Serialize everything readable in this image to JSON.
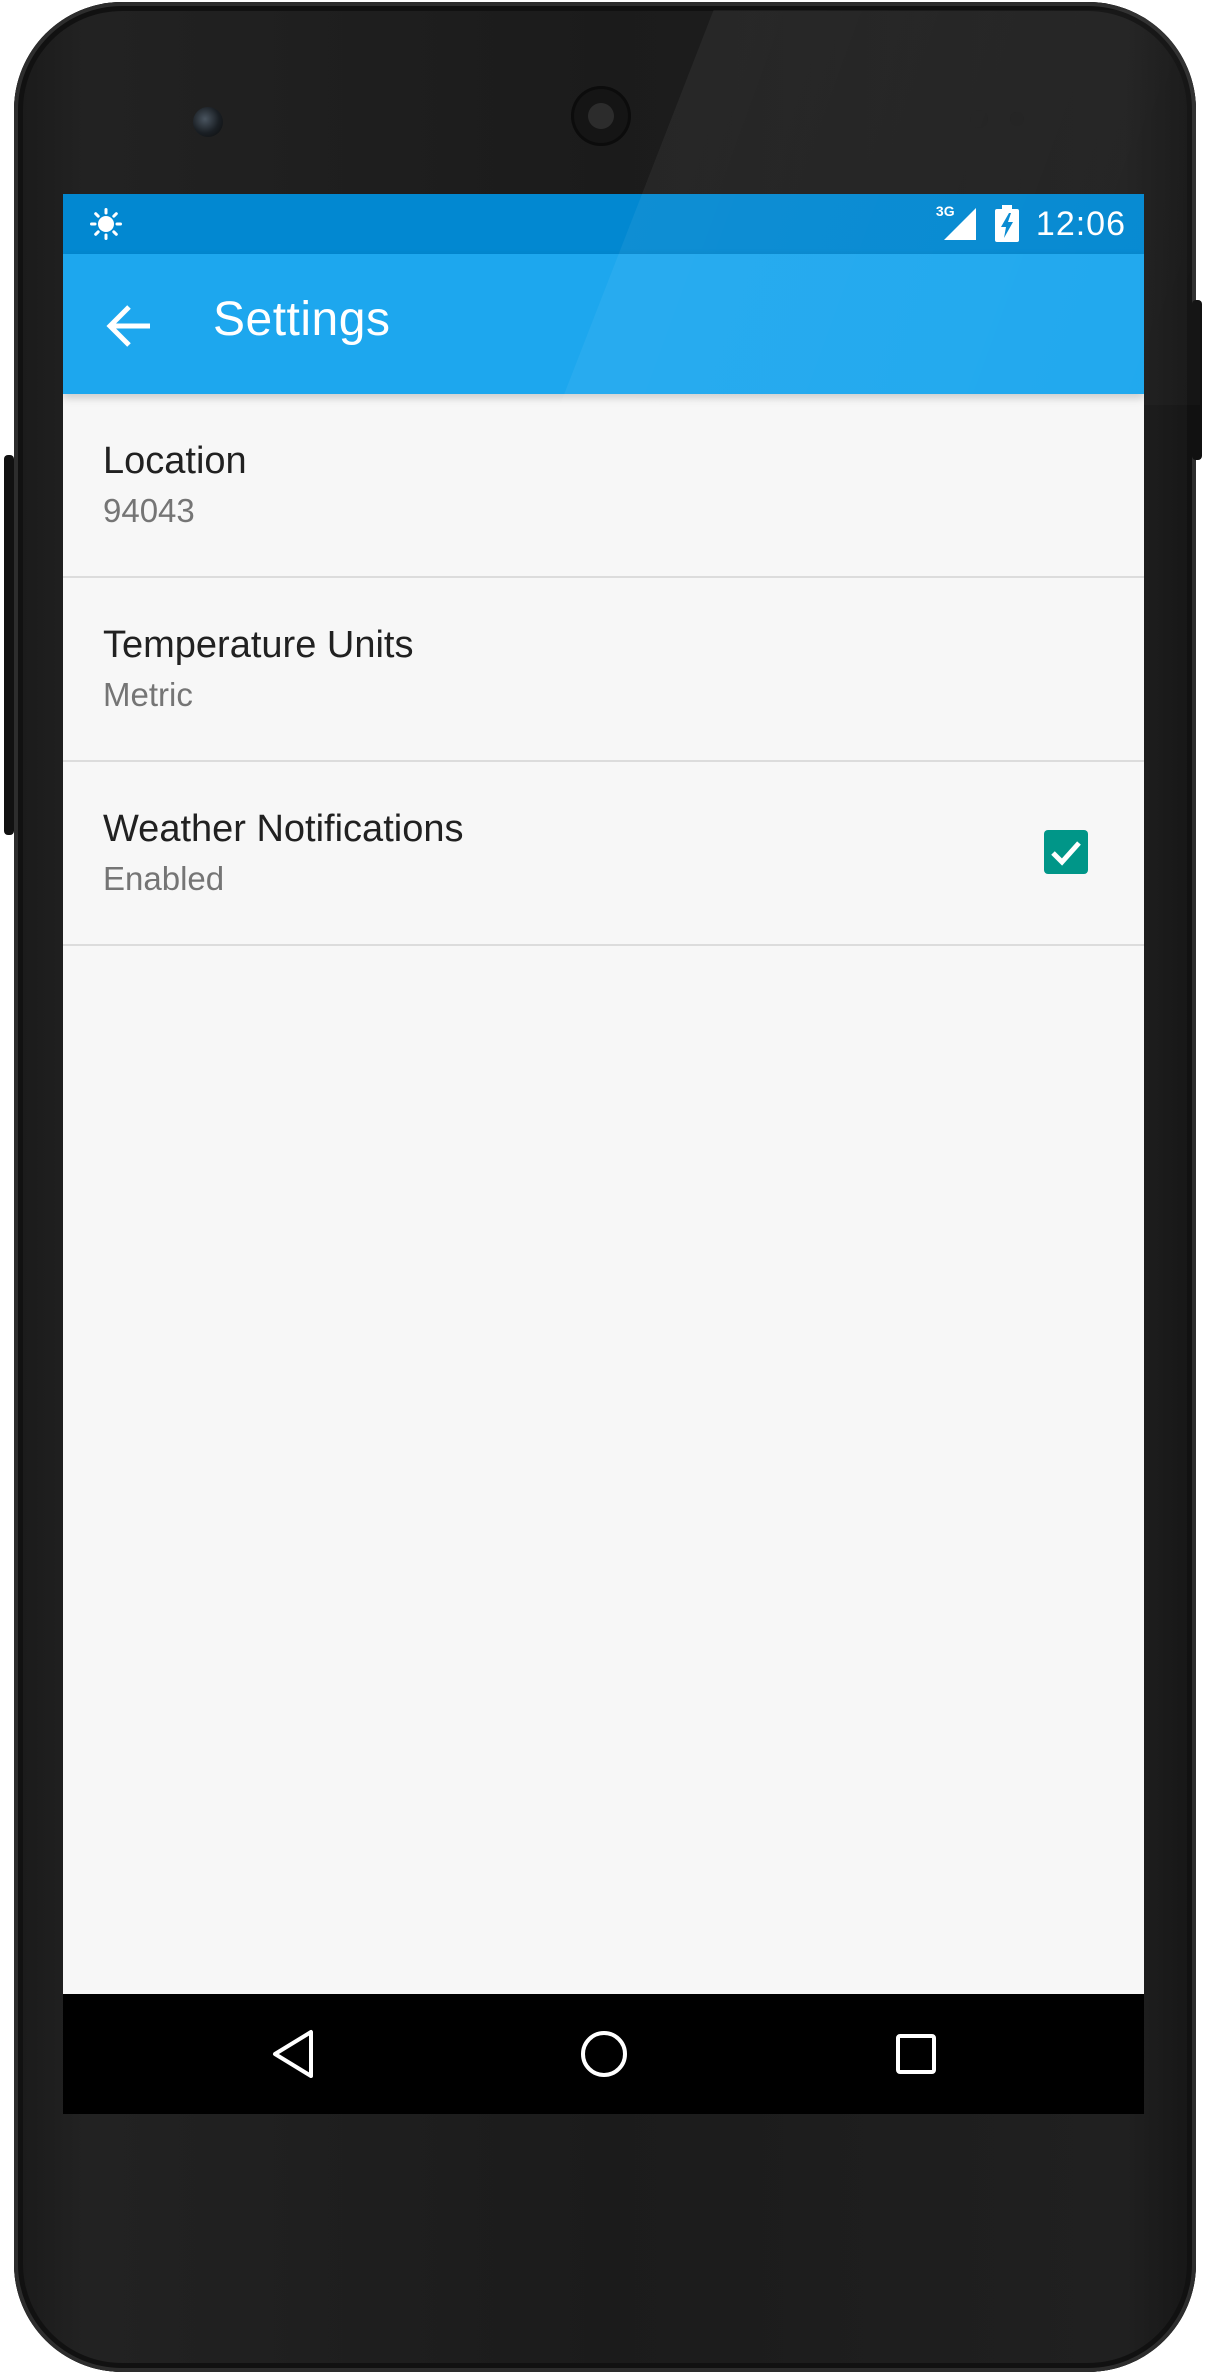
{
  "status_bar": {
    "network": "3G",
    "time": "12:06"
  },
  "toolbar": {
    "title": "Settings",
    "back_icon": "arrow-back-icon",
    "color": "#1da7ee"
  },
  "settings": [
    {
      "title": "Location",
      "summary": "94043"
    },
    {
      "title": "Temperature Units",
      "summary": "Metric"
    },
    {
      "title": "Weather Notifications",
      "summary": "Enabled",
      "checked": true
    }
  ],
  "nav_bar": {
    "back_icon": "nav-back-icon",
    "home_icon": "nav-home-icon",
    "recents_icon": "nav-recents-icon"
  },
  "colors": {
    "status_bar": "#0288d1",
    "accent": "#009688",
    "background": "#f7f7f7"
  }
}
